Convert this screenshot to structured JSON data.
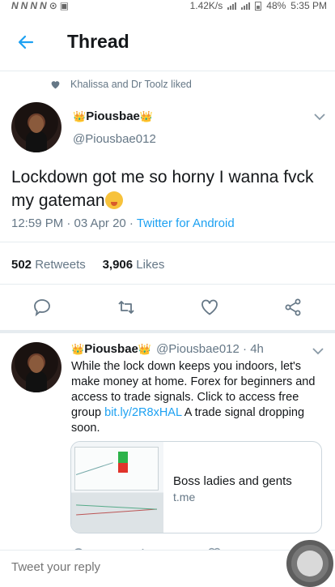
{
  "status_bar": {
    "network_glyphs": [
      "N",
      "N",
      "N",
      "N"
    ],
    "speed": "1.42K/s",
    "battery": "48%",
    "time": "5:35 PM"
  },
  "header": {
    "title": "Thread"
  },
  "social_context": {
    "text": "Khalissa and Dr Toolz liked"
  },
  "main_tweet": {
    "display_name": "Piousbae",
    "crown_emoji": "👑",
    "handle": "@Piousbae012",
    "text": "Lockdown got me so horny I wanna fvck my gateman",
    "timestamp": "12:59 PM · 03 Apr 20 · ",
    "source": "Twitter for Android",
    "retweets_count": "502",
    "retweets_label": "Retweets",
    "likes_count": "3,906",
    "likes_label": "Likes"
  },
  "reply_tweet": {
    "display_name": "Piousbae",
    "handle_time": "@Piousbae012 · 4h",
    "text_before_link": "While the lock down keeps you indoors, let's make money at home. Forex for beginners and access to trade signals. Click to access free group ",
    "link": "bit.ly/2R8xHAL",
    "text_after_link": " A trade signal dropping soon.",
    "card": {
      "title": "Boss ladies and gents",
      "domain": "t.me"
    }
  },
  "reply_bar": {
    "placeholder": "Tweet your reply"
  },
  "colors": {
    "accent": "#1da1f2",
    "secondary_text": "#657786",
    "divider": "#e6ecf0"
  },
  "icons": [
    "back-arrow-icon",
    "heart-icon",
    "chevron-down-icon",
    "reply-icon",
    "retweet-icon",
    "like-icon",
    "share-icon"
  ]
}
